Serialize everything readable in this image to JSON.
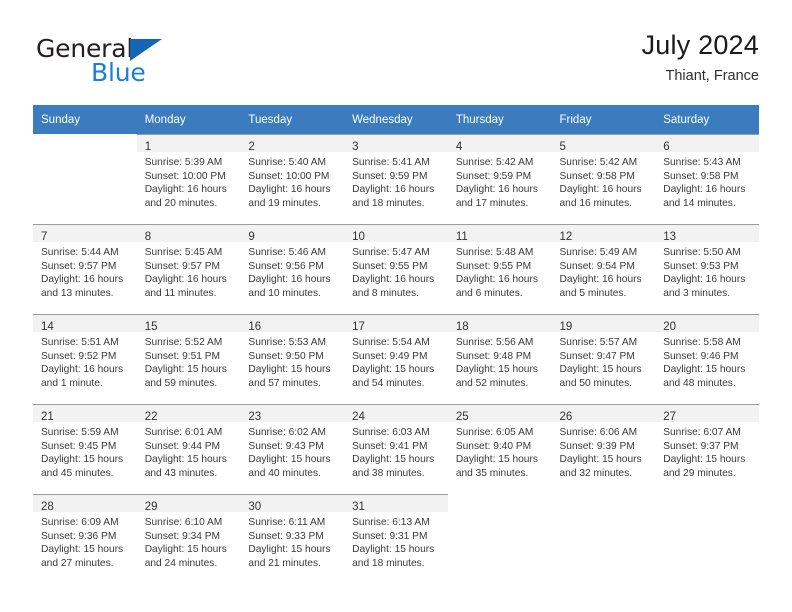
{
  "brand": {
    "name_part1": "General",
    "name_part2": "Blue",
    "logo_icon": "triangle-logo-icon"
  },
  "header": {
    "title": "July 2024",
    "subtitle": "Thiant, France"
  },
  "calendar": {
    "weekday_headers": [
      "Sunday",
      "Monday",
      "Tuesday",
      "Wednesday",
      "Thursday",
      "Friday",
      "Saturday"
    ],
    "accent_color": "#3a7cbe",
    "daynum_bar_color": "#f2f2f2",
    "grid_line_color": "#9c9c9c",
    "weeks": [
      [
        {
          "day": "",
          "sunrise": "",
          "sunset": "",
          "daylight_line1": "",
          "daylight_line2": "",
          "empty": true
        },
        {
          "day": "1",
          "sunrise": "Sunrise: 5:39 AM",
          "sunset": "Sunset: 10:00 PM",
          "daylight_line1": "Daylight: 16 hours",
          "daylight_line2": "and 20 minutes.",
          "empty": false
        },
        {
          "day": "2",
          "sunrise": "Sunrise: 5:40 AM",
          "sunset": "Sunset: 10:00 PM",
          "daylight_line1": "Daylight: 16 hours",
          "daylight_line2": "and 19 minutes.",
          "empty": false
        },
        {
          "day": "3",
          "sunrise": "Sunrise: 5:41 AM",
          "sunset": "Sunset: 9:59 PM",
          "daylight_line1": "Daylight: 16 hours",
          "daylight_line2": "and 18 minutes.",
          "empty": false
        },
        {
          "day": "4",
          "sunrise": "Sunrise: 5:42 AM",
          "sunset": "Sunset: 9:59 PM",
          "daylight_line1": "Daylight: 16 hours",
          "daylight_line2": "and 17 minutes.",
          "empty": false
        },
        {
          "day": "5",
          "sunrise": "Sunrise: 5:42 AM",
          "sunset": "Sunset: 9:58 PM",
          "daylight_line1": "Daylight: 16 hours",
          "daylight_line2": "and 16 minutes.",
          "empty": false
        },
        {
          "day": "6",
          "sunrise": "Sunrise: 5:43 AM",
          "sunset": "Sunset: 9:58 PM",
          "daylight_line1": "Daylight: 16 hours",
          "daylight_line2": "and 14 minutes.",
          "empty": false
        }
      ],
      [
        {
          "day": "7",
          "sunrise": "Sunrise: 5:44 AM",
          "sunset": "Sunset: 9:57 PM",
          "daylight_line1": "Daylight: 16 hours",
          "daylight_line2": "and 13 minutes.",
          "empty": false
        },
        {
          "day": "8",
          "sunrise": "Sunrise: 5:45 AM",
          "sunset": "Sunset: 9:57 PM",
          "daylight_line1": "Daylight: 16 hours",
          "daylight_line2": "and 11 minutes.",
          "empty": false
        },
        {
          "day": "9",
          "sunrise": "Sunrise: 5:46 AM",
          "sunset": "Sunset: 9:56 PM",
          "daylight_line1": "Daylight: 16 hours",
          "daylight_line2": "and 10 minutes.",
          "empty": false
        },
        {
          "day": "10",
          "sunrise": "Sunrise: 5:47 AM",
          "sunset": "Sunset: 9:55 PM",
          "daylight_line1": "Daylight: 16 hours",
          "daylight_line2": "and 8 minutes.",
          "empty": false
        },
        {
          "day": "11",
          "sunrise": "Sunrise: 5:48 AM",
          "sunset": "Sunset: 9:55 PM",
          "daylight_line1": "Daylight: 16 hours",
          "daylight_line2": "and 6 minutes.",
          "empty": false
        },
        {
          "day": "12",
          "sunrise": "Sunrise: 5:49 AM",
          "sunset": "Sunset: 9:54 PM",
          "daylight_line1": "Daylight: 16 hours",
          "daylight_line2": "and 5 minutes.",
          "empty": false
        },
        {
          "day": "13",
          "sunrise": "Sunrise: 5:50 AM",
          "sunset": "Sunset: 9:53 PM",
          "daylight_line1": "Daylight: 16 hours",
          "daylight_line2": "and 3 minutes.",
          "empty": false
        }
      ],
      [
        {
          "day": "14",
          "sunrise": "Sunrise: 5:51 AM",
          "sunset": "Sunset: 9:52 PM",
          "daylight_line1": "Daylight: 16 hours",
          "daylight_line2": "and 1 minute.",
          "empty": false
        },
        {
          "day": "15",
          "sunrise": "Sunrise: 5:52 AM",
          "sunset": "Sunset: 9:51 PM",
          "daylight_line1": "Daylight: 15 hours",
          "daylight_line2": "and 59 minutes.",
          "empty": false
        },
        {
          "day": "16",
          "sunrise": "Sunrise: 5:53 AM",
          "sunset": "Sunset: 9:50 PM",
          "daylight_line1": "Daylight: 15 hours",
          "daylight_line2": "and 57 minutes.",
          "empty": false
        },
        {
          "day": "17",
          "sunrise": "Sunrise: 5:54 AM",
          "sunset": "Sunset: 9:49 PM",
          "daylight_line1": "Daylight: 15 hours",
          "daylight_line2": "and 54 minutes.",
          "empty": false
        },
        {
          "day": "18",
          "sunrise": "Sunrise: 5:56 AM",
          "sunset": "Sunset: 9:48 PM",
          "daylight_line1": "Daylight: 15 hours",
          "daylight_line2": "and 52 minutes.",
          "empty": false
        },
        {
          "day": "19",
          "sunrise": "Sunrise: 5:57 AM",
          "sunset": "Sunset: 9:47 PM",
          "daylight_line1": "Daylight: 15 hours",
          "daylight_line2": "and 50 minutes.",
          "empty": false
        },
        {
          "day": "20",
          "sunrise": "Sunrise: 5:58 AM",
          "sunset": "Sunset: 9:46 PM",
          "daylight_line1": "Daylight: 15 hours",
          "daylight_line2": "and 48 minutes.",
          "empty": false
        }
      ],
      [
        {
          "day": "21",
          "sunrise": "Sunrise: 5:59 AM",
          "sunset": "Sunset: 9:45 PM",
          "daylight_line1": "Daylight: 15 hours",
          "daylight_line2": "and 45 minutes.",
          "empty": false
        },
        {
          "day": "22",
          "sunrise": "Sunrise: 6:01 AM",
          "sunset": "Sunset: 9:44 PM",
          "daylight_line1": "Daylight: 15 hours",
          "daylight_line2": "and 43 minutes.",
          "empty": false
        },
        {
          "day": "23",
          "sunrise": "Sunrise: 6:02 AM",
          "sunset": "Sunset: 9:43 PM",
          "daylight_line1": "Daylight: 15 hours",
          "daylight_line2": "and 40 minutes.",
          "empty": false
        },
        {
          "day": "24",
          "sunrise": "Sunrise: 6:03 AM",
          "sunset": "Sunset: 9:41 PM",
          "daylight_line1": "Daylight: 15 hours",
          "daylight_line2": "and 38 minutes.",
          "empty": false
        },
        {
          "day": "25",
          "sunrise": "Sunrise: 6:05 AM",
          "sunset": "Sunset: 9:40 PM",
          "daylight_line1": "Daylight: 15 hours",
          "daylight_line2": "and 35 minutes.",
          "empty": false
        },
        {
          "day": "26",
          "sunrise": "Sunrise: 6:06 AM",
          "sunset": "Sunset: 9:39 PM",
          "daylight_line1": "Daylight: 15 hours",
          "daylight_line2": "and 32 minutes.",
          "empty": false
        },
        {
          "day": "27",
          "sunrise": "Sunrise: 6:07 AM",
          "sunset": "Sunset: 9:37 PM",
          "daylight_line1": "Daylight: 15 hours",
          "daylight_line2": "and 29 minutes.",
          "empty": false
        }
      ],
      [
        {
          "day": "28",
          "sunrise": "Sunrise: 6:09 AM",
          "sunset": "Sunset: 9:36 PM",
          "daylight_line1": "Daylight: 15 hours",
          "daylight_line2": "and 27 minutes.",
          "empty": false
        },
        {
          "day": "29",
          "sunrise": "Sunrise: 6:10 AM",
          "sunset": "Sunset: 9:34 PM",
          "daylight_line1": "Daylight: 15 hours",
          "daylight_line2": "and 24 minutes.",
          "empty": false
        },
        {
          "day": "30",
          "sunrise": "Sunrise: 6:11 AM",
          "sunset": "Sunset: 9:33 PM",
          "daylight_line1": "Daylight: 15 hours",
          "daylight_line2": "and 21 minutes.",
          "empty": false
        },
        {
          "day": "31",
          "sunrise": "Sunrise: 6:13 AM",
          "sunset": "Sunset: 9:31 PM",
          "daylight_line1": "Daylight: 15 hours",
          "daylight_line2": "and 18 minutes.",
          "empty": false
        },
        {
          "day": "",
          "sunrise": "",
          "sunset": "",
          "daylight_line1": "",
          "daylight_line2": "",
          "empty": true
        },
        {
          "day": "",
          "sunrise": "",
          "sunset": "",
          "daylight_line1": "",
          "daylight_line2": "",
          "empty": true
        },
        {
          "day": "",
          "sunrise": "",
          "sunset": "",
          "daylight_line1": "",
          "daylight_line2": "",
          "empty": true
        }
      ]
    ]
  }
}
